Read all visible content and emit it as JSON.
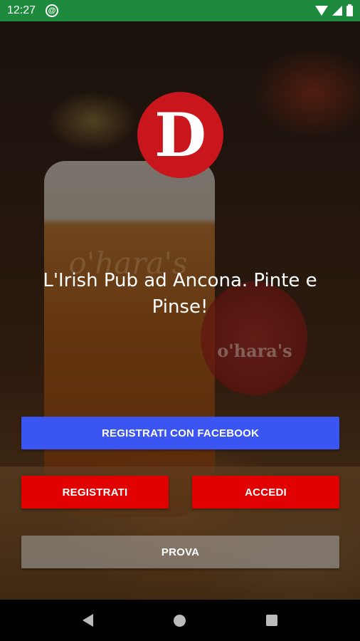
{
  "status_bar": {
    "time": "12:27",
    "sync_glyph": "@",
    "icons": [
      "sync-icon",
      "wifi-icon",
      "signal-icon",
      "battery-icon"
    ]
  },
  "background": {
    "glass_logo_text": "o'hara's",
    "tap_badge_text": "o'hara's"
  },
  "logo": {
    "letter": "D",
    "color": "#c8161c"
  },
  "headline": "L'Irish Pub ad Ancona. Pinte e Pinse!",
  "buttons": {
    "facebook": "REGISTRATI CON FACEBOOK",
    "register": "REGISTRATI",
    "login": "ACCEDI",
    "try": "PROVA"
  },
  "colors": {
    "status_bar": "#1e8a3e",
    "facebook": "#3b55f2",
    "primary": "#e10000"
  },
  "nav_bar": {
    "icons": [
      "back-icon",
      "home-icon",
      "recents-icon"
    ]
  }
}
